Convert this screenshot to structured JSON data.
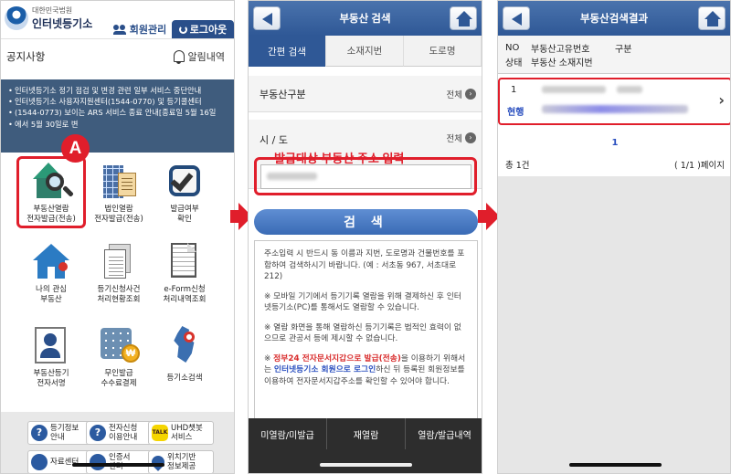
{
  "panel1": {
    "logo_sub": "대한민국법원",
    "logo_main": "인터넷등기소",
    "tab_member": "회원관리",
    "tab_logout": "로그아웃",
    "notice_title": "공지사항",
    "alert_label": "알림내역",
    "notices": [
      "인터넷등기소 정기 점검 및 변경 관련 일부 서비스 중단안내",
      "인터넷등기소 사용자지원센터(1544-0770) 및 등기콜센터",
      "(1544-0773) 보이는 ARS 서비스 종료 안내[종료일 5월 16일",
      "에서 5월 30일로 변"
    ],
    "badge": "A",
    "menu": [
      {
        "line1": "부동산열람",
        "line2": "전자발급(전송)"
      },
      {
        "line1": "법인열람",
        "line2": "전자발급(전송)"
      },
      {
        "line1": "발급여부",
        "line2": "확인"
      },
      {
        "line1": "나의 관심",
        "line2": "부동산"
      },
      {
        "line1": "등기신청사건",
        "line2": "처리현황조회"
      },
      {
        "line1": "e-Form신청",
        "line2": "처리내역조회"
      },
      {
        "line1": "부동산등기",
        "line2": "전자서명"
      },
      {
        "line1": "무인발급",
        "line2": "수수료결제"
      },
      {
        "line1": "등기소검색",
        "line2": ""
      }
    ],
    "coin_symbol": "₩",
    "tiles": [
      {
        "line1": "등기정보",
        "line2": "안내",
        "icon": "?"
      },
      {
        "line1": "전자신청",
        "line2": "이용안내",
        "icon": "?"
      },
      {
        "line1": "UHD챗봇",
        "line2": "서비스",
        "icon": "TALK"
      },
      {
        "line1": "자료센터",
        "line2": "",
        "icon": ""
      },
      {
        "line1": "인증서",
        "line2": "센터",
        "icon": ""
      },
      {
        "line1": "위치기반",
        "line2": "정보제공",
        "icon": ""
      }
    ]
  },
  "panel2": {
    "title": "부동산 검색",
    "tabs": [
      "간편 검색",
      "소재지번",
      "도로명"
    ],
    "field_type_label": "부동산구분",
    "field_type_value": "전체",
    "field_sido_label": "시 / 도",
    "field_sido_value": "전체",
    "annotation": "발급대상 부동산 주소 입력",
    "search_button": "검 색",
    "help": [
      "주소입력 시 반드시 동 이름과 지번, 도로명과 건물번호를 포함하여 검색하시기 바랍니다. (예 : 서초동 967, 서초대로 212)",
      "※ 모바일 기기에서 등기기록 열람을 위해 결제하신 후 인터넷등기소(PC)를 통해서도 열람할 수 있습니다.",
      "※ 열람 화면을 통해 열람하신 등기기록은 법적인 효력이 없으므로 관공서 등에 제시할 수 없습니다."
    ],
    "help_last_prefix": "※ ",
    "help_last_em1": "정부24 전자문서지갑으로 발급(전송)",
    "help_last_mid": "을 이용하기 위해서는 ",
    "help_last_em2": "인터넷등기소 회원으로 로그인",
    "help_last_tail": "하신 뒤 등록된 회원정보를 이용하여 전자문서지갑주소를 확인할 수 있어야 합니다.",
    "bottom_menu": [
      "미열람/미발급",
      "재열람",
      "열람/발급내역"
    ]
  },
  "panel3": {
    "title": "부동산검색결과",
    "head_no": "NO",
    "head_code": "부동산고유번호",
    "head_kind": "구분",
    "head_status": "상태",
    "head_address": "부동산 소재지번",
    "row_no": "1",
    "row_status": "현행",
    "page_number": "1",
    "total_count": "총 1건",
    "page_info": "( 1/1 )페이지"
  }
}
